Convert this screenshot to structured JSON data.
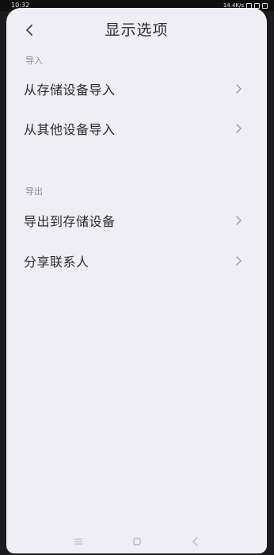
{
  "status_bar": {
    "time": "10:32",
    "speed": "14.4K/s"
  },
  "header": {
    "title": "显示选项"
  },
  "sections": {
    "import": {
      "label": "导入",
      "items": [
        {
          "label": "从存储设备导入"
        },
        {
          "label": "从其他设备导入"
        }
      ]
    },
    "export": {
      "label": "导出",
      "items": [
        {
          "label": "导出到存储设备"
        },
        {
          "label": "分享联系人"
        }
      ]
    }
  },
  "icons": {
    "back": "chevron-left-icon",
    "item_arrow": "chevron-right-icon",
    "nav_menu": "menu-icon",
    "nav_home": "home-square-icon",
    "nav_back": "back-triangle-icon"
  },
  "colors": {
    "background": "#eeeef4",
    "text_primary": "#2b2b2b",
    "text_secondary": "#8a8a90"
  }
}
